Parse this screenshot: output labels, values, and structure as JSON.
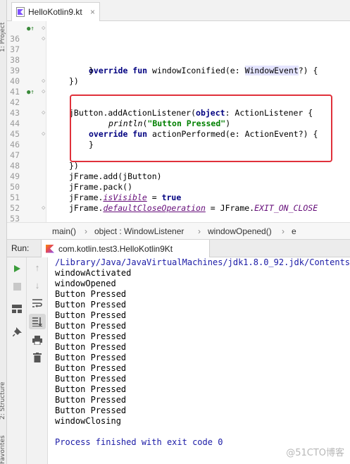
{
  "side_strip": {
    "top_label": "1: Project",
    "bottom_label": "2: Structure",
    "bottom_label2": "Favorites"
  },
  "tab": {
    "filename": "HelloKotlin9.kt",
    "close": "×"
  },
  "editor": {
    "lines": [
      {
        "num": "36",
        "marker": "●↑"
      },
      {
        "num": "37"
      },
      {
        "num": "38"
      },
      {
        "num": "39"
      },
      {
        "num": "40"
      },
      {
        "num": "41"
      },
      {
        "num": "42",
        "marker": "●↑"
      },
      {
        "num": "43"
      },
      {
        "num": "44"
      },
      {
        "num": "45"
      },
      {
        "num": "46"
      },
      {
        "num": "47"
      },
      {
        "num": "48"
      },
      {
        "num": "49"
      },
      {
        "num": "50"
      },
      {
        "num": "51"
      },
      {
        "num": "52"
      },
      {
        "num": "53"
      }
    ],
    "code": {
      "l36_kw": "override fun",
      "l36_fn": " windowIconified(e: ",
      "l36_type": "WindowEvent",
      "l36_end": "?) {",
      "l37": "}",
      "l39": "})",
      "l41_a": "jButton.addActionListener(",
      "l41_kw": "object",
      "l41_b": ": ActionListener {",
      "l42_kw": "override fun",
      "l42_rest": " actionPerformed(e: ActionEvent?) {",
      "l43_fn": "println",
      "l43_open": "(",
      "l43_str": "\"Button Pressed\"",
      "l43_close": ")",
      "l44": "}",
      "l46": "})",
      "l48": "jFrame.add(jButton)",
      "l49": "jFrame.pack()",
      "l50_a": "jFrame.",
      "l50_prop": "isVisible",
      "l50_b": " = ",
      "l50_kw": "true",
      "l51_a": "jFrame.",
      "l51_prop": "defaultCloseOperation",
      "l51_b": " = JFrame.",
      "l51_const": "EXIT_ON_CLOSE",
      "l53": "}"
    }
  },
  "breadcrumb": [
    "main()",
    "object : WindowListener",
    "windowOpened()",
    "e"
  ],
  "breadcrumb_sep": "›",
  "run": {
    "title": "Run:",
    "tab_label": "com.kotlin.test3.HelloKotlin9Kt"
  },
  "console": {
    "lines": [
      "/Library/Java/JavaVirtualMachines/jdk1.8.0_92.jdk/Contents/H",
      "windowActivated",
      "windowOpened",
      "Button Pressed",
      "Button Pressed",
      "Button Pressed",
      "Button Pressed",
      "Button Pressed",
      "Button Pressed",
      "Button Pressed",
      "Button Pressed",
      "Button Pressed",
      "Button Pressed",
      "Button Pressed",
      "Button Pressed",
      "windowClosing"
    ],
    "finish": "Process finished with exit code 0"
  },
  "watermark": "@51CTO博客",
  "colors": {
    "highlight_box": "#e0313b",
    "keyword": "#000080",
    "string": "#008000",
    "console_blue": "#1a1aa6"
  }
}
